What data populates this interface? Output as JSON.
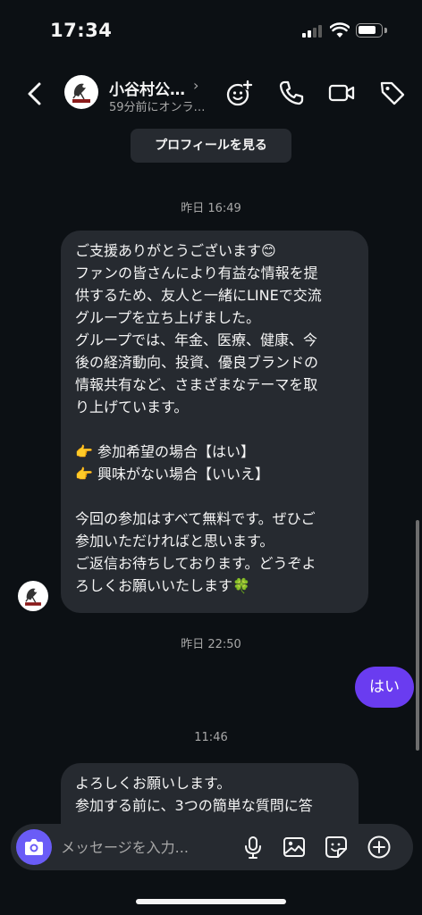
{
  "status_bar": {
    "time": "17:34"
  },
  "header": {
    "contact_name": "小谷村公…",
    "chevron": "›",
    "status": "59分前にオンラ…",
    "icons": [
      "back-icon",
      "add-to-chat-icon",
      "phone-icon",
      "video-icon",
      "tag-icon"
    ]
  },
  "profile_button": "プロフィールを見る",
  "messages": {
    "ts1": "昨日 16:49",
    "msg1_lines": [
      "ご支援ありがとうございます😊",
      "ファンの皆さんにより有益な情報を提",
      "供するため、友人と一緒にLINEで交流",
      "グループを立ち上げました。",
      "グループでは、年金、医療、健康、今",
      "後の経済動向、投資、優良ブランドの",
      "情報共有など、さまざまなテーマを取",
      "り上げています。",
      "",
      "👉 参加希望の場合【はい】",
      "👉 興味がない場合【いいえ】",
      "",
      "今回の参加はすべて無料です。ぜひご",
      "参加いただければと思います。",
      "ご返信お待ちしております。どうぞよ",
      "ろしくお願いいたします🍀"
    ],
    "ts2": "昨日 22:50",
    "reply": "はい",
    "ts3": "11:46",
    "msg2_lines": [
      "よろしくお願いします。",
      "参加する前に、3つの簡単な質問に答"
    ]
  },
  "composer": {
    "placeholder": "メッセージを入力...",
    "icons": [
      "camera-icon",
      "microphone-icon",
      "image-icon",
      "sticker-icon",
      "plus-icon"
    ]
  },
  "colors": {
    "background": "#0c1014",
    "bubble_in": "#262a30",
    "bubble_out": "#6a3cf0",
    "camera_accent": "#6a5cf7"
  }
}
